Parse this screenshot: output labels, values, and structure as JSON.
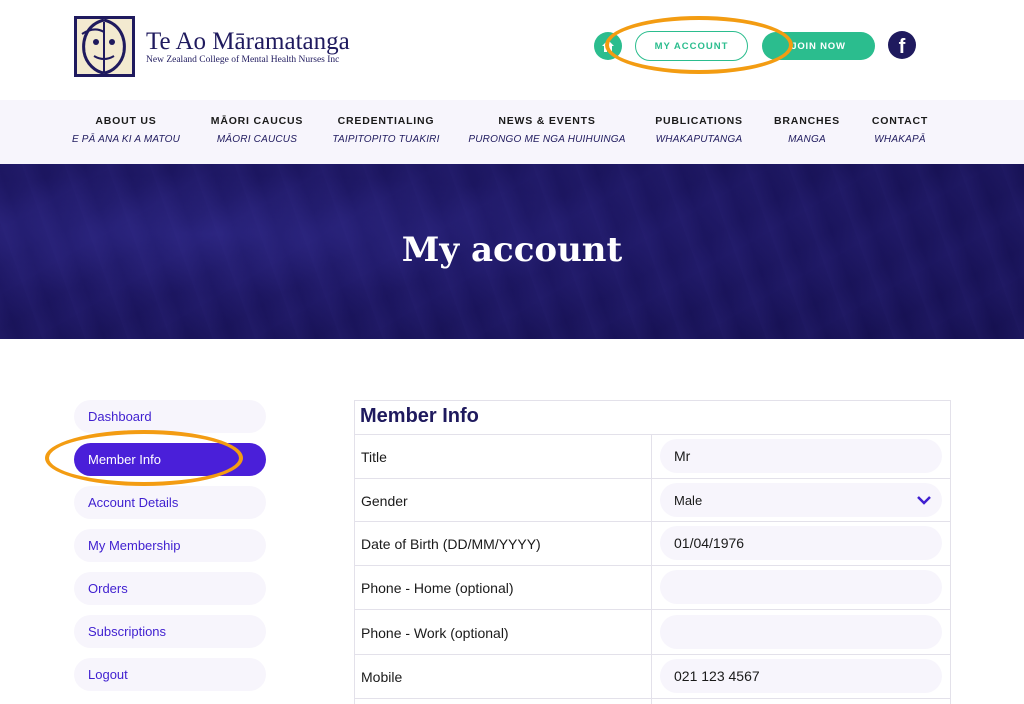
{
  "header": {
    "logo_title": "Te Ao Māramatanga",
    "logo_subtitle": "New Zealand College of Mental Health Nurses Inc",
    "my_account_label": "MY ACCOUNT",
    "join_now_label": "JOIN NOW",
    "home_icon": "home-icon",
    "facebook_icon": "facebook-icon",
    "facebook_glyph": "f"
  },
  "nav": {
    "items": [
      {
        "label": "ABOUT US",
        "sub": "E PĀ ANA KI A MATOU"
      },
      {
        "label": "MĀORI CAUCUS",
        "sub": "MĀORI CAUCUS"
      },
      {
        "label": "CREDENTIALING",
        "sub": "TAIPITOPITO TUAKIRI"
      },
      {
        "label": "NEWS & EVENTS",
        "sub": "PURONGO ME NGA HUIHUINGA"
      },
      {
        "label": "PUBLICATIONS",
        "sub": "WHAKAPUTANGA"
      },
      {
        "label": "BRANCHES",
        "sub": "MANGA"
      },
      {
        "label": "CONTACT",
        "sub": "WHAKAPĀ"
      }
    ]
  },
  "hero": {
    "title": "My account"
  },
  "sidebar": {
    "items": [
      {
        "label": "Dashboard"
      },
      {
        "label": "Member Info"
      },
      {
        "label": "Account Details"
      },
      {
        "label": "My Membership"
      },
      {
        "label": "Orders"
      },
      {
        "label": "Subscriptions"
      },
      {
        "label": "Logout"
      }
    ],
    "active_index": 1
  },
  "member_info": {
    "heading": "Member Info",
    "rows": [
      {
        "label": "Title",
        "value": ""
      },
      {
        "label": "Gender",
        "value": "Male"
      },
      {
        "label": "Date of Birth (DD/MM/YYYY)",
        "value": "01/04/1976"
      },
      {
        "label": "Phone - Home (optional)",
        "value": ""
      },
      {
        "label": "Phone - Work (optional)",
        "value": ""
      },
      {
        "label": "Mobile",
        "value": "021 123 4567"
      }
    ],
    "title_value": "Mr"
  },
  "colors": {
    "brand_navy": "#1f1a5e",
    "accent_green": "#2bbd8e",
    "accent_purple": "#4a1fd9",
    "highlight_orange": "#f39c12"
  }
}
